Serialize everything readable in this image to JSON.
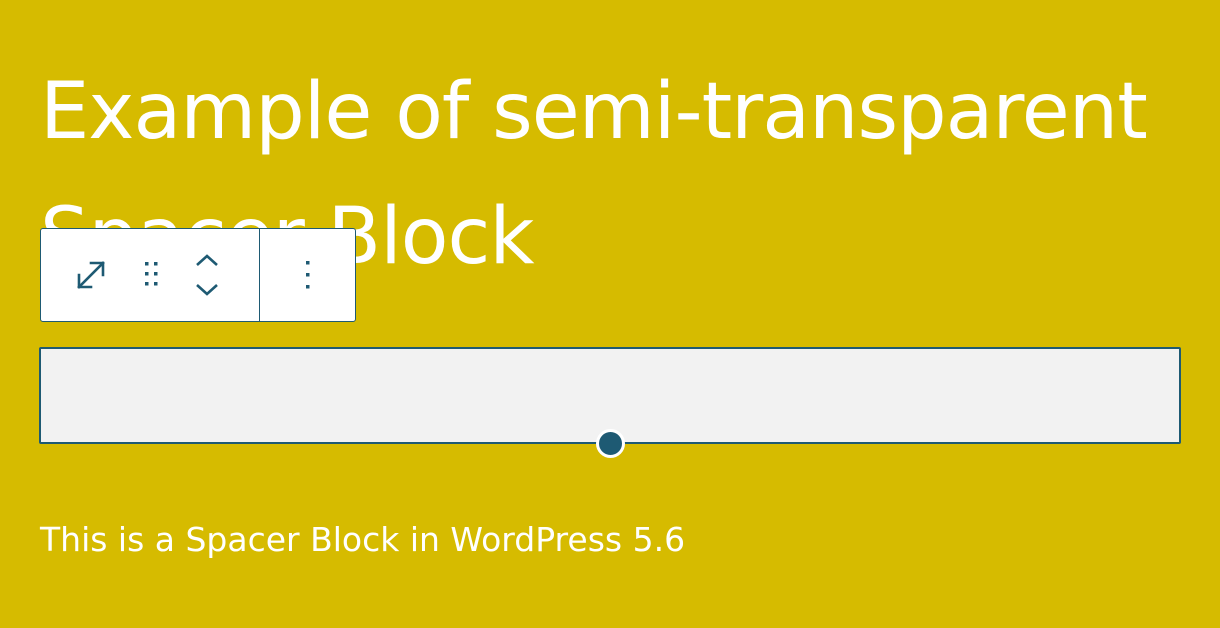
{
  "heading": {
    "text": "Example of semi-transparent Spacer Block"
  },
  "toolbar": {
    "buttons": [
      {
        "icon": "resize-arrows-icon"
      },
      {
        "icon": "drag-handle-icon"
      },
      {
        "icon": "chevron-up-icon"
      },
      {
        "icon": "chevron-down-icon"
      },
      {
        "icon": "more-options-icon"
      }
    ]
  },
  "spacer": {
    "label": ""
  },
  "paragraph": {
    "text": "This is a Spacer Block in WordPress 5.6"
  },
  "colors": {
    "background": "#d6bb00",
    "accent": "#1e5a73",
    "spacer_fill": "#f2f2f2",
    "text": "#ffffff"
  }
}
